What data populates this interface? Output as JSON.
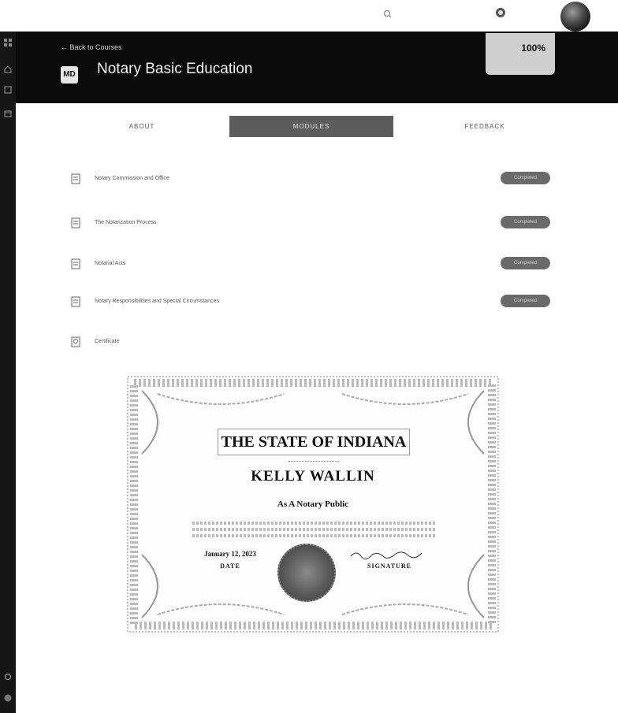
{
  "topbar": {
    "search_label": "",
    "user_name": ""
  },
  "header": {
    "back_label": "← Back to Courses",
    "course_logo_text": "MD",
    "course_title": "Notary Basic Education",
    "course_author": "",
    "progress_value": "100%",
    "progress_label": "",
    "certificate_link": ""
  },
  "tabs": [
    {
      "label": "ABOUT",
      "active": false
    },
    {
      "label": "MODULES",
      "active": true
    },
    {
      "label": "FEEDBACK",
      "active": false
    }
  ],
  "modules": [
    {
      "title": "Notary Commission and Office",
      "status": "Completed",
      "icon": "module-icon"
    },
    {
      "title": "The Notarization Process",
      "status": "Completed",
      "icon": "module-icon"
    },
    {
      "title": "Notarial Acts",
      "status": "Completed",
      "icon": "module-icon"
    },
    {
      "title": "Notary Responsibilities and Special Circumstances",
      "status": "Completed",
      "icon": "module-icon"
    },
    {
      "title": "Certificate",
      "status": "",
      "icon": "certificate-icon"
    }
  ],
  "certificate": {
    "state_title": "THE STATE OF INDIANA",
    "name": "KELLY WALLIN",
    "role": "As A Notary Public",
    "date": "January 12, 2023",
    "date_label": "DATE",
    "signature_label": "SIGNATURE"
  },
  "colors": {
    "header_bg": "#0b0b0b",
    "sidebar_bg": "#161616",
    "active_tab": "#5c5c5c",
    "badge": "#6a6a6a"
  }
}
